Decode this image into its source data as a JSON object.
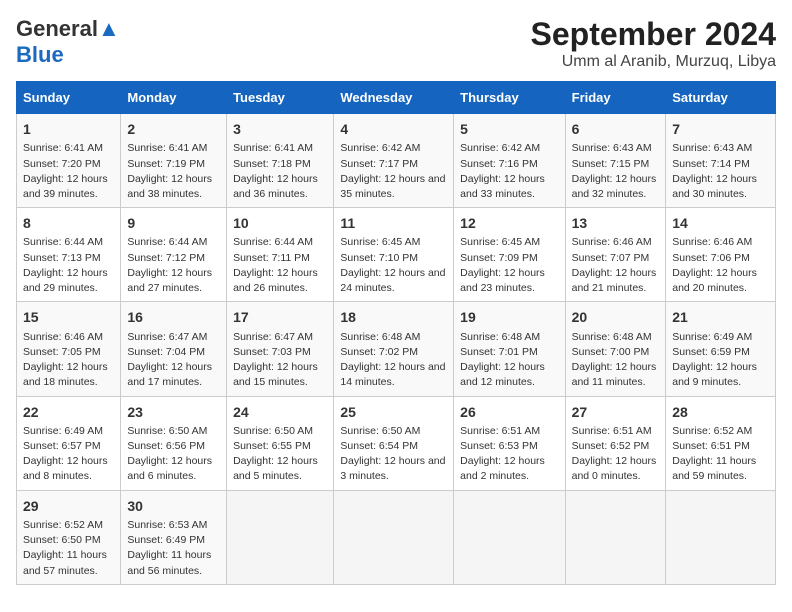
{
  "header": {
    "logo_line1": "General",
    "logo_line2": "Blue",
    "title": "September 2024",
    "subtitle": "Umm al Aranib, Murzuq, Libya"
  },
  "calendar": {
    "days_of_week": [
      "Sunday",
      "Monday",
      "Tuesday",
      "Wednesday",
      "Thursday",
      "Friday",
      "Saturday"
    ],
    "weeks": [
      [
        {
          "day": "1",
          "info": "Sunrise: 6:41 AM\nSunset: 7:20 PM\nDaylight: 12 hours and 39 minutes."
        },
        {
          "day": "2",
          "info": "Sunrise: 6:41 AM\nSunset: 7:19 PM\nDaylight: 12 hours and 38 minutes."
        },
        {
          "day": "3",
          "info": "Sunrise: 6:41 AM\nSunset: 7:18 PM\nDaylight: 12 hours and 36 minutes."
        },
        {
          "day": "4",
          "info": "Sunrise: 6:42 AM\nSunset: 7:17 PM\nDaylight: 12 hours and 35 minutes."
        },
        {
          "day": "5",
          "info": "Sunrise: 6:42 AM\nSunset: 7:16 PM\nDaylight: 12 hours and 33 minutes."
        },
        {
          "day": "6",
          "info": "Sunrise: 6:43 AM\nSunset: 7:15 PM\nDaylight: 12 hours and 32 minutes."
        },
        {
          "day": "7",
          "info": "Sunrise: 6:43 AM\nSunset: 7:14 PM\nDaylight: 12 hours and 30 minutes."
        }
      ],
      [
        {
          "day": "8",
          "info": "Sunrise: 6:44 AM\nSunset: 7:13 PM\nDaylight: 12 hours and 29 minutes."
        },
        {
          "day": "9",
          "info": "Sunrise: 6:44 AM\nSunset: 7:12 PM\nDaylight: 12 hours and 27 minutes."
        },
        {
          "day": "10",
          "info": "Sunrise: 6:44 AM\nSunset: 7:11 PM\nDaylight: 12 hours and 26 minutes."
        },
        {
          "day": "11",
          "info": "Sunrise: 6:45 AM\nSunset: 7:10 PM\nDaylight: 12 hours and 24 minutes."
        },
        {
          "day": "12",
          "info": "Sunrise: 6:45 AM\nSunset: 7:09 PM\nDaylight: 12 hours and 23 minutes."
        },
        {
          "day": "13",
          "info": "Sunrise: 6:46 AM\nSunset: 7:07 PM\nDaylight: 12 hours and 21 minutes."
        },
        {
          "day": "14",
          "info": "Sunrise: 6:46 AM\nSunset: 7:06 PM\nDaylight: 12 hours and 20 minutes."
        }
      ],
      [
        {
          "day": "15",
          "info": "Sunrise: 6:46 AM\nSunset: 7:05 PM\nDaylight: 12 hours and 18 minutes."
        },
        {
          "day": "16",
          "info": "Sunrise: 6:47 AM\nSunset: 7:04 PM\nDaylight: 12 hours and 17 minutes."
        },
        {
          "day": "17",
          "info": "Sunrise: 6:47 AM\nSunset: 7:03 PM\nDaylight: 12 hours and 15 minutes."
        },
        {
          "day": "18",
          "info": "Sunrise: 6:48 AM\nSunset: 7:02 PM\nDaylight: 12 hours and 14 minutes."
        },
        {
          "day": "19",
          "info": "Sunrise: 6:48 AM\nSunset: 7:01 PM\nDaylight: 12 hours and 12 minutes."
        },
        {
          "day": "20",
          "info": "Sunrise: 6:48 AM\nSunset: 7:00 PM\nDaylight: 12 hours and 11 minutes."
        },
        {
          "day": "21",
          "info": "Sunrise: 6:49 AM\nSunset: 6:59 PM\nDaylight: 12 hours and 9 minutes."
        }
      ],
      [
        {
          "day": "22",
          "info": "Sunrise: 6:49 AM\nSunset: 6:57 PM\nDaylight: 12 hours and 8 minutes."
        },
        {
          "day": "23",
          "info": "Sunrise: 6:50 AM\nSunset: 6:56 PM\nDaylight: 12 hours and 6 minutes."
        },
        {
          "day": "24",
          "info": "Sunrise: 6:50 AM\nSunset: 6:55 PM\nDaylight: 12 hours and 5 minutes."
        },
        {
          "day": "25",
          "info": "Sunrise: 6:50 AM\nSunset: 6:54 PM\nDaylight: 12 hours and 3 minutes."
        },
        {
          "day": "26",
          "info": "Sunrise: 6:51 AM\nSunset: 6:53 PM\nDaylight: 12 hours and 2 minutes."
        },
        {
          "day": "27",
          "info": "Sunrise: 6:51 AM\nSunset: 6:52 PM\nDaylight: 12 hours and 0 minutes."
        },
        {
          "day": "28",
          "info": "Sunrise: 6:52 AM\nSunset: 6:51 PM\nDaylight: 11 hours and 59 minutes."
        }
      ],
      [
        {
          "day": "29",
          "info": "Sunrise: 6:52 AM\nSunset: 6:50 PM\nDaylight: 11 hours and 57 minutes."
        },
        {
          "day": "30",
          "info": "Sunrise: 6:53 AM\nSunset: 6:49 PM\nDaylight: 11 hours and 56 minutes."
        },
        {
          "day": "",
          "info": ""
        },
        {
          "day": "",
          "info": ""
        },
        {
          "day": "",
          "info": ""
        },
        {
          "day": "",
          "info": ""
        },
        {
          "day": "",
          "info": ""
        }
      ]
    ]
  }
}
